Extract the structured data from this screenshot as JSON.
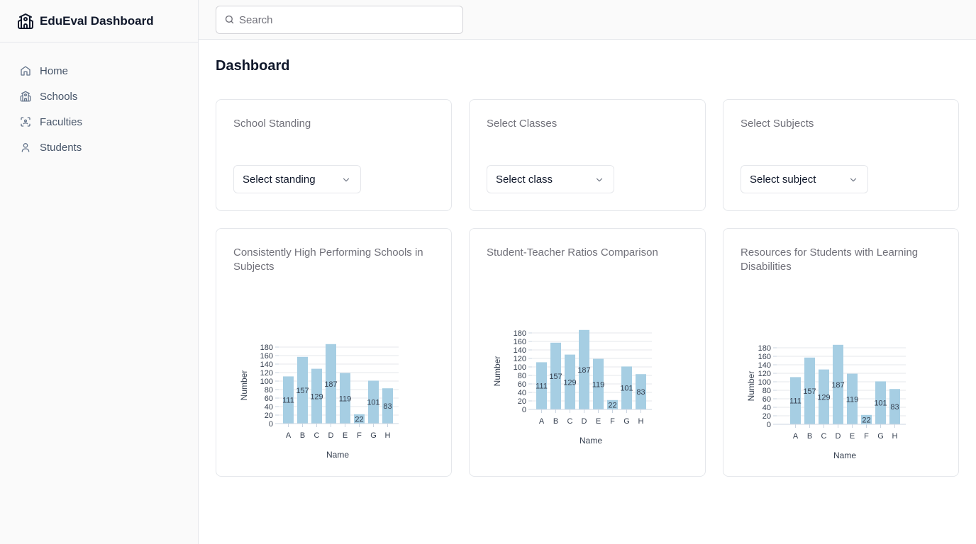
{
  "app": {
    "title": "EduEval Dashboard",
    "logo_icon": "school-building-icon"
  },
  "sidebar": {
    "items": [
      {
        "label": "Home",
        "icon": "home-icon"
      },
      {
        "label": "Schools",
        "icon": "school-icon"
      },
      {
        "label": "Faculties",
        "icon": "faculty-scan-icon"
      },
      {
        "label": "Students",
        "icon": "user-icon"
      }
    ]
  },
  "search": {
    "placeholder": "Search",
    "value": ""
  },
  "page": {
    "title": "Dashboard"
  },
  "filters": [
    {
      "title": "School Standing",
      "selected": "Select standing"
    },
    {
      "title": "Select Classes",
      "selected": "Select class"
    },
    {
      "title": "Select Subjects",
      "selected": "Select subject"
    }
  ],
  "charts": [
    {
      "title": "Consistently High Performing Schools in Subjects"
    },
    {
      "title": "Student-Teacher Ratios Comparison"
    },
    {
      "title": "Resources for Students with Learning Disabilities"
    }
  ],
  "colors": {
    "bar": "#a6cee3",
    "accent": "#0f172a",
    "muted": "#71717a"
  },
  "chart_data": [
    {
      "type": "bar",
      "title": "Consistently High Performing Schools in Subjects",
      "categories": [
        "A",
        "B",
        "C",
        "D",
        "E",
        "F",
        "G",
        "H"
      ],
      "values": [
        111,
        157,
        129,
        187,
        119,
        22,
        101,
        83
      ],
      "xlabel": "Name",
      "ylabel": "Number",
      "ylim": [
        0,
        190
      ],
      "yticks": [
        0,
        20,
        40,
        60,
        80,
        100,
        120,
        140,
        160,
        180
      ],
      "grid": true
    },
    {
      "type": "bar",
      "title": "Student-Teacher Ratios Comparison",
      "categories": [
        "A",
        "B",
        "C",
        "D",
        "E",
        "F",
        "G",
        "H"
      ],
      "values": [
        111,
        157,
        129,
        187,
        119,
        22,
        101,
        83
      ],
      "xlabel": "Name",
      "ylabel": "Number",
      "ylim": [
        0,
        190
      ],
      "yticks": [
        0,
        20,
        40,
        60,
        80,
        100,
        120,
        140,
        160,
        180
      ],
      "grid": true
    },
    {
      "type": "bar",
      "title": "Resources for Students with Learning Disabilities",
      "categories": [
        "A",
        "B",
        "C",
        "D",
        "E",
        "F",
        "G",
        "H"
      ],
      "values": [
        111,
        157,
        129,
        187,
        119,
        22,
        101,
        83
      ],
      "xlabel": "Name",
      "ylabel": "Number",
      "ylim": [
        0,
        190
      ],
      "yticks": [
        0,
        20,
        40,
        60,
        80,
        100,
        120,
        140,
        160,
        180
      ],
      "grid": true
    }
  ]
}
